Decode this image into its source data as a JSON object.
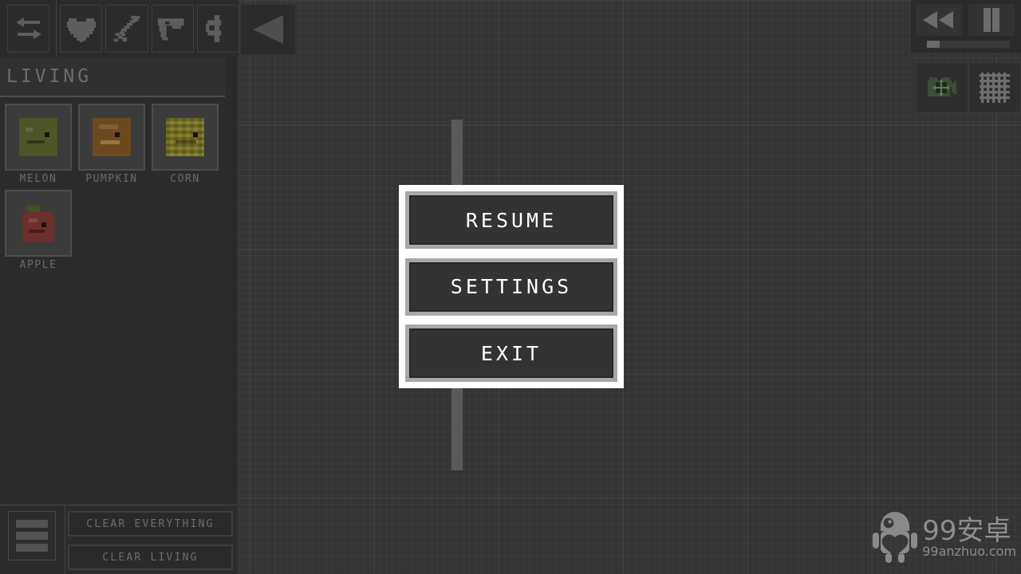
{
  "toolbar": {
    "transfer_icon": "swap-arrows-icon",
    "categories": [
      {
        "name": "heart-icon",
        "label": "Life"
      },
      {
        "name": "sword-icon",
        "label": "Weapons"
      },
      {
        "name": "pistol-icon",
        "label": "Guns"
      },
      {
        "name": "partial-icon",
        "label": "More"
      }
    ],
    "collapse_label": "collapse-panel"
  },
  "palette": {
    "title": "LIVING",
    "items": [
      {
        "label": "MELON",
        "sprite": "melon",
        "color": "#4e5527"
      },
      {
        "label": "PUMPKIN",
        "sprite": "pumpkin",
        "color": "#6d4a1e"
      },
      {
        "label": "CORN",
        "sprite": "corn",
        "color": "#7a7420"
      },
      {
        "label": "APPLE",
        "sprite": "apple",
        "color": "#6d2f2b"
      }
    ]
  },
  "bottom_bar": {
    "menu_icon": "hamburger-menu-icon",
    "clear_everything_label": "CLEAR EVERYTHING",
    "clear_living_label": "CLEAR LIVING"
  },
  "playback": {
    "rewind_icon": "rewind-icon",
    "pause_icon": "pause-icon",
    "speed_value": 0
  },
  "right_tools": [
    {
      "name": "camera-move-icon",
      "color": "#3a5036"
    },
    {
      "name": "grid-toggle-icon",
      "color": "#6f6f6f"
    }
  ],
  "pause_dialog": {
    "buttons": [
      {
        "label": "RESUME"
      },
      {
        "label": "SETTINGS"
      },
      {
        "label": "EXIT"
      }
    ]
  },
  "watermark": {
    "main": "99安卓",
    "sub": "99anzhuo.com",
    "mascot": "android-robot-icon"
  },
  "colors": {
    "background": "#343434",
    "panel": "#2c2c2c",
    "dialog_border": "#ffffff",
    "button_frame": "#a8a8a8",
    "button_face": "#333333",
    "text_muted": "#6b6b6b",
    "text_bright": "#ffffff"
  }
}
